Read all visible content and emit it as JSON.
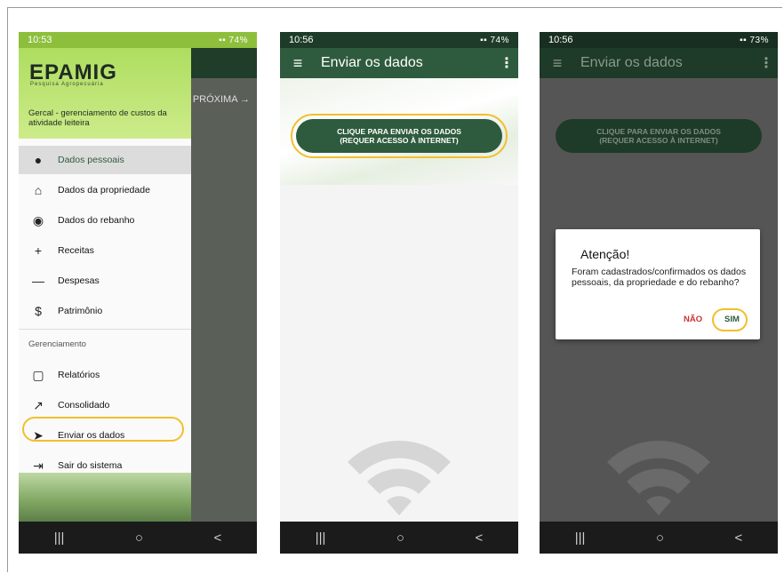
{
  "screens": {
    "drawer": {
      "status_time": "10:53",
      "status_battery": "74%",
      "logo": "EPAMIG",
      "logo_sub": "Pesquisa Agropecuária",
      "app_description": "Gercal - gerenciamento de custos da atividade leiteira",
      "background_next": "PRÓXIMA",
      "items": [
        {
          "label": "Dados pessoais",
          "icon": "person-icon"
        },
        {
          "label": "Dados da propriedade",
          "icon": "home-icon"
        },
        {
          "label": "Dados do rebanho",
          "icon": "herd-icon"
        },
        {
          "label": "Receitas",
          "icon": "plus-icon"
        },
        {
          "label": "Despesas",
          "icon": "minus-icon"
        },
        {
          "label": "Patrimônio",
          "icon": "dollar-icon"
        }
      ],
      "section_label": "Gerenciamento",
      "management_items": [
        {
          "label": "Relatórios",
          "icon": "clipboard-icon"
        },
        {
          "label": "Consolidado",
          "icon": "trend-icon"
        },
        {
          "label": "Enviar os dados",
          "icon": "send-icon"
        },
        {
          "label": "Sair do sistema",
          "icon": "exit-icon"
        }
      ]
    },
    "send": {
      "status_time": "10:56",
      "status_battery": "74%",
      "title": "Enviar os dados",
      "button_line1": "CLIQUE PARA ENVIAR OS DADOS",
      "button_line2": "(REQUER ACESSO À INTERNET)"
    },
    "confirm": {
      "status_time": "10:56",
      "status_battery": "73%",
      "title": "Enviar os dados",
      "button_line1": "CLIQUE PARA ENVIAR OS DADOS",
      "button_line2": "(REQUER ACESSO À INTERNET)",
      "dialog_title": "Atenção!",
      "dialog_body": "Foram cadastrados/confirmados os dados pessoais, da propriedade e do rebanho?",
      "no_label": "NÃO",
      "yes_label": "SIM"
    }
  },
  "nav_buttons": [
    "|||",
    "○",
    "<"
  ],
  "colors": {
    "app_green": "#2e5b3d",
    "highlight": "#f2bf2c",
    "header_lime": "#a8db58",
    "no_red": "#c73333"
  }
}
